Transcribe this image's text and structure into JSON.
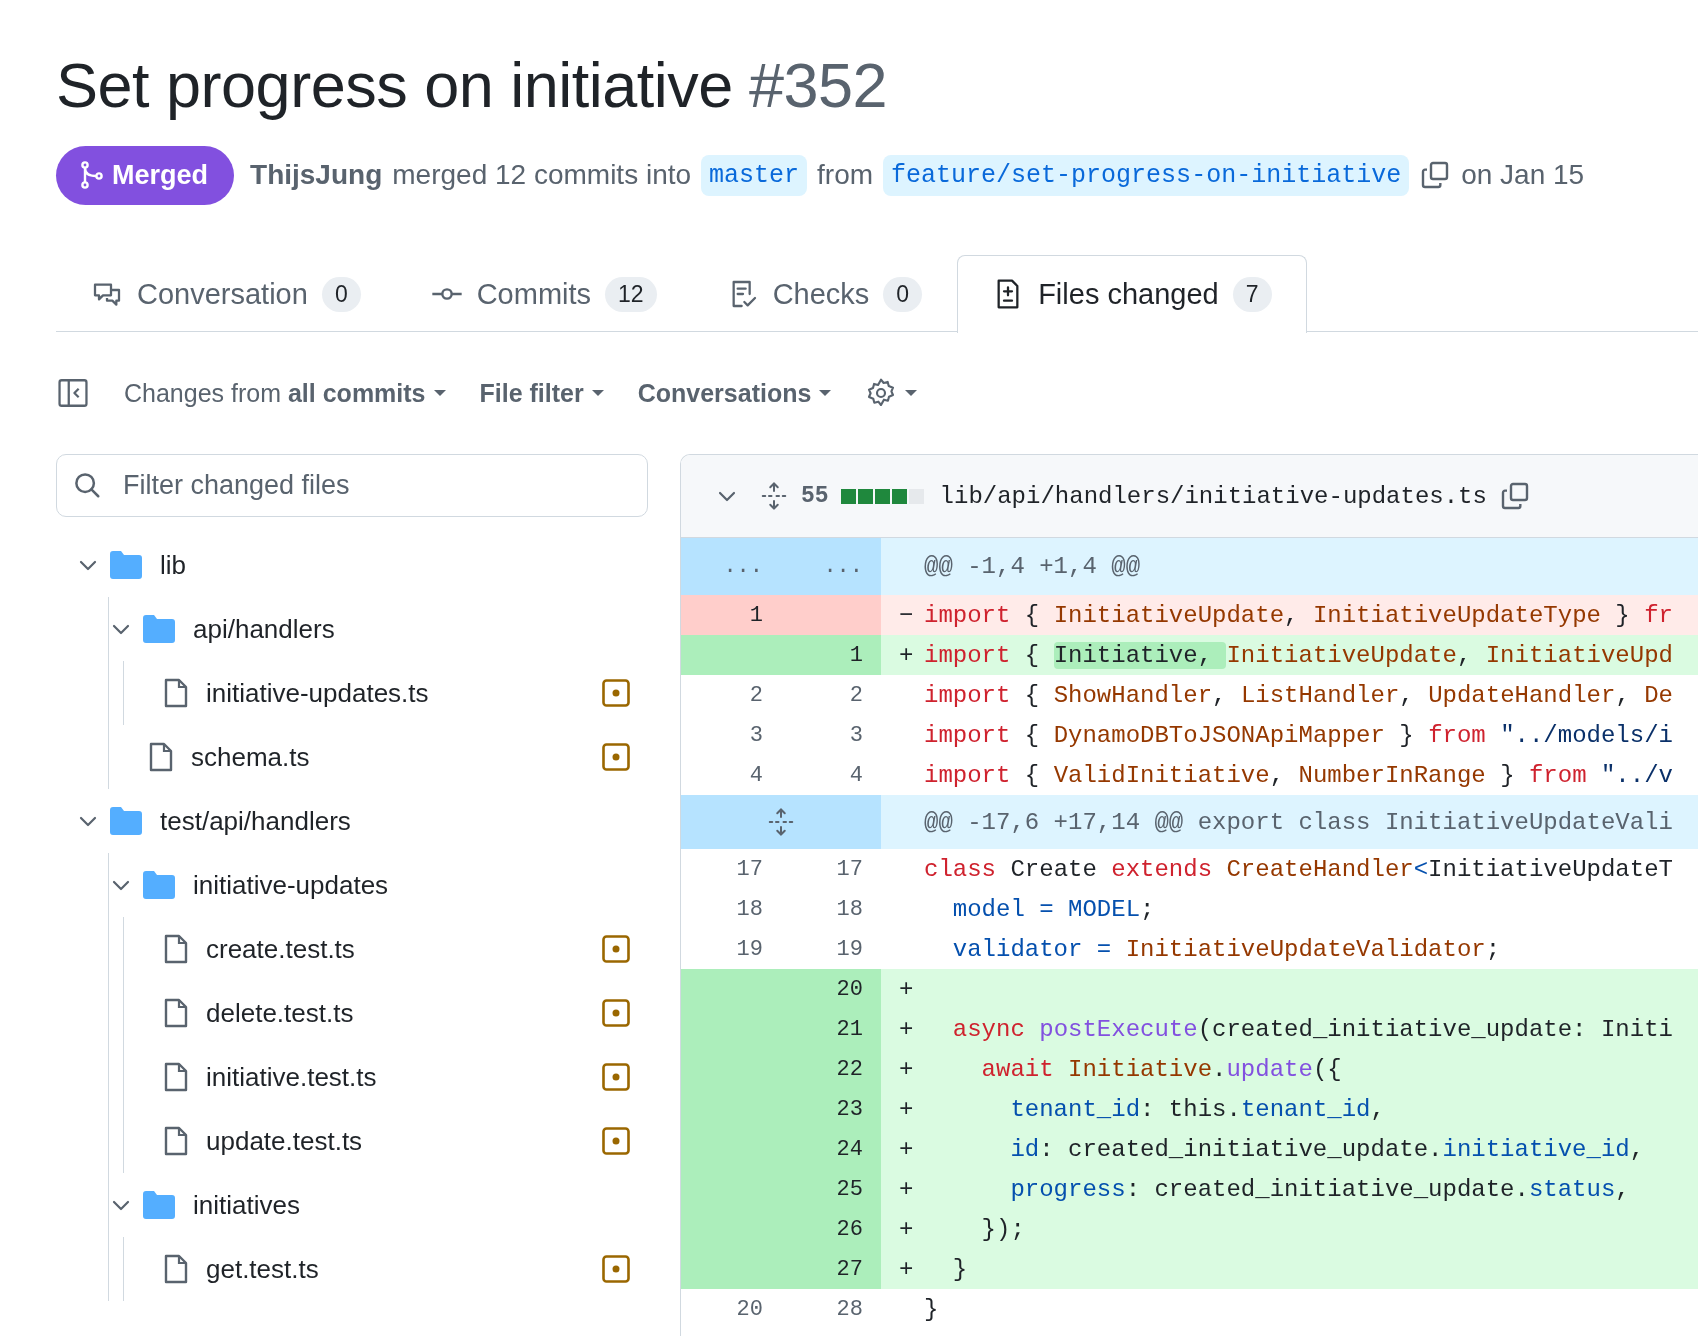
{
  "pr": {
    "title": "Set progress on initiative",
    "number": "#352",
    "state_badge": {
      "label": "Merged"
    },
    "author": "ThijsJung",
    "action": "merged 12 commits into",
    "base_branch": "master",
    "from_text": "from",
    "head_branch": "feature/set-progress-on-initiative",
    "date": "on Jan 15"
  },
  "tabs": [
    {
      "label": "Conversation",
      "count": "0",
      "selected": false
    },
    {
      "label": "Commits",
      "count": "12",
      "selected": false
    },
    {
      "label": "Checks",
      "count": "0",
      "selected": false
    },
    {
      "label": "Files changed",
      "count": "7",
      "selected": true
    }
  ],
  "toolbar": {
    "changes_from": "Changes from **all commits**",
    "file_filter": "File filter",
    "conversations": "Conversations"
  },
  "file_filter": {
    "placeholder": "Filter changed files"
  },
  "file_tree": [
    {
      "kind": "folder",
      "name": "lib",
      "expanded": true,
      "children": [
        {
          "kind": "folder",
          "name": "api/handlers",
          "expanded": true,
          "children": [
            {
              "kind": "file",
              "name": "initiative-updates.ts",
              "modified": true
            }
          ]
        },
        {
          "kind": "file",
          "name": "schema.ts",
          "modified": true
        }
      ]
    },
    {
      "kind": "folder",
      "name": "test/api/handlers",
      "expanded": true,
      "children": [
        {
          "kind": "folder",
          "name": "initiative-updates",
          "expanded": true,
          "children": [
            {
              "kind": "file",
              "name": "create.test.ts",
              "modified": true
            },
            {
              "kind": "file",
              "name": "delete.test.ts",
              "modified": true
            },
            {
              "kind": "file",
              "name": "initiative.test.ts",
              "modified": true
            },
            {
              "kind": "file",
              "name": "update.test.ts",
              "modified": true
            }
          ]
        },
        {
          "kind": "folder",
          "name": "initiatives",
          "expanded": true,
          "children": [
            {
              "kind": "file",
              "name": "get.test.ts",
              "modified": true
            }
          ]
        }
      ]
    }
  ],
  "diff": {
    "expanded": true,
    "changes": "55",
    "level": 0.8,
    "path": "lib/api/handlers/initiative-updates.ts",
    "lines": [
      {
        "kind": "hunk",
        "old": "...",
        "new": "...",
        "tokens": [
          {
            "kind": "hunk",
            "text": "@@ -1,4 +1,4 @@"
          }
        ]
      },
      {
        "kind": "del",
        "old": "1",
        "sign": "−",
        "tokens": [
          {
            "kind": "keyword",
            "text": "import"
          },
          {
            "kind": "plain",
            "text": " { "
          },
          {
            "kind": "type",
            "text": "InitiativeUpdate"
          },
          {
            "kind": "plain",
            "text": ", "
          },
          {
            "kind": "type",
            "text": "InitiativeUpdateType"
          },
          {
            "kind": "plain",
            "text": " } "
          },
          {
            "kind": "keyword",
            "text": "fr"
          }
        ]
      },
      {
        "kind": "add",
        "new": "1",
        "sign": "+",
        "tokens": [
          {
            "kind": "keyword",
            "text": "import"
          },
          {
            "kind": "plain",
            "text": " { "
          },
          {
            "kind": "highlight",
            "text": "Initiative, "
          },
          {
            "kind": "type",
            "text": "InitiativeUpdate"
          },
          {
            "kind": "plain",
            "text": ", "
          },
          {
            "kind": "type",
            "text": "InitiativeUpd"
          }
        ]
      },
      {
        "kind": "ctx",
        "old": "2",
        "new": "2",
        "tokens": [
          {
            "kind": "keyword",
            "text": "import"
          },
          {
            "kind": "plain",
            "text": " { "
          },
          {
            "kind": "type",
            "text": "ShowHandler"
          },
          {
            "kind": "plain",
            "text": ", "
          },
          {
            "kind": "type",
            "text": "ListHandler"
          },
          {
            "kind": "plain",
            "text": ", "
          },
          {
            "kind": "type",
            "text": "UpdateHandler"
          },
          {
            "kind": "plain",
            "text": ", "
          },
          {
            "kind": "type",
            "text": "De"
          }
        ]
      },
      {
        "kind": "ctx",
        "old": "3",
        "new": "3",
        "tokens": [
          {
            "kind": "keyword",
            "text": "import"
          },
          {
            "kind": "plain",
            "text": " { "
          },
          {
            "kind": "type",
            "text": "DynamoDBToJSONApiMapper"
          },
          {
            "kind": "plain",
            "text": " } "
          },
          {
            "kind": "keyword",
            "text": "from"
          },
          {
            "kind": "string",
            "text": " \"../models/i"
          }
        ]
      },
      {
        "kind": "ctx",
        "old": "4",
        "new": "4",
        "tokens": [
          {
            "kind": "keyword",
            "text": "import"
          },
          {
            "kind": "plain",
            "text": " { "
          },
          {
            "kind": "type",
            "text": "ValidInitiative"
          },
          {
            "kind": "plain",
            "text": ", "
          },
          {
            "kind": "type",
            "text": "NumberInRange"
          },
          {
            "kind": "plain",
            "text": " } "
          },
          {
            "kind": "keyword",
            "text": "from"
          },
          {
            "kind": "string",
            "text": " \"../v"
          }
        ]
      },
      {
        "kind": "hunk_expand",
        "tokens": [
          {
            "kind": "hunk",
            "text": "@@ -17,6 +17,14 @@ export class InitiativeUpdateVali"
          }
        ]
      },
      {
        "kind": "ctx",
        "old": "17",
        "new": "17",
        "tokens": [
          {
            "kind": "keyword",
            "text": "class"
          },
          {
            "kind": "plain",
            "text": " Create "
          },
          {
            "kind": "keyword",
            "text": "extends"
          },
          {
            "kind": "type",
            "text": " CreateHandler"
          },
          {
            "kind": "property",
            "text": "<"
          },
          {
            "kind": "plain",
            "text": "InitiativeUpdateT"
          }
        ]
      },
      {
        "kind": "ctx",
        "old": "18",
        "new": "18",
        "tokens": [
          {
            "kind": "property",
            "text": "  model = MODEL"
          },
          {
            "kind": "plain",
            "text": ";"
          }
        ]
      },
      {
        "kind": "ctx",
        "old": "19",
        "new": "19",
        "tokens": [
          {
            "kind": "property",
            "text": "  validator ="
          },
          {
            "kind": "type",
            "text": " InitiativeUpdateValidator"
          },
          {
            "kind": "plain",
            "text": ";"
          }
        ]
      },
      {
        "kind": "add",
        "new": "20",
        "sign": "+"
      },
      {
        "kind": "add",
        "new": "21",
        "sign": "+",
        "tokens": [
          {
            "kind": "keyword",
            "text": "  async"
          },
          {
            "kind": "function",
            "text": " postExecute"
          },
          {
            "kind": "plain",
            "text": "(created_initiative_update: Initi"
          }
        ]
      },
      {
        "kind": "add",
        "new": "22",
        "sign": "+",
        "tokens": [
          {
            "kind": "keyword",
            "text": "    await"
          },
          {
            "kind": "type",
            "text": " Initiative"
          },
          {
            "kind": "plain",
            "text": "."
          },
          {
            "kind": "function",
            "text": "update"
          },
          {
            "kind": "plain",
            "text": "({"
          }
        ]
      },
      {
        "kind": "add",
        "new": "23",
        "sign": "+",
        "tokens": [
          {
            "kind": "property",
            "text": "      tenant_id"
          },
          {
            "kind": "plain",
            "text": ": this."
          },
          {
            "kind": "property",
            "text": "tenant_id"
          },
          {
            "kind": "plain",
            "text": ","
          }
        ]
      },
      {
        "kind": "add",
        "new": "24",
        "sign": "+",
        "tokens": [
          {
            "kind": "property",
            "text": "      id"
          },
          {
            "kind": "plain",
            "text": ": created_initiative_update."
          },
          {
            "kind": "property",
            "text": "initiative_id"
          },
          {
            "kind": "plain",
            "text": ","
          }
        ]
      },
      {
        "kind": "add",
        "new": "25",
        "sign": "+",
        "tokens": [
          {
            "kind": "property",
            "text": "      progress"
          },
          {
            "kind": "plain",
            "text": ": created_initiative_update."
          },
          {
            "kind": "property",
            "text": "status"
          },
          {
            "kind": "plain",
            "text": ","
          }
        ]
      },
      {
        "kind": "add",
        "new": "26",
        "sign": "+",
        "tokens": [
          {
            "kind": "plain",
            "text": "    });"
          }
        ]
      },
      {
        "kind": "add",
        "new": "27",
        "sign": "+",
        "tokens": [
          {
            "kind": "plain",
            "text": "  }"
          }
        ]
      },
      {
        "kind": "ctx",
        "old": "20",
        "new": "28",
        "tokens": [
          {
            "kind": "plain",
            "text": "}"
          }
        ]
      }
    ]
  }
}
